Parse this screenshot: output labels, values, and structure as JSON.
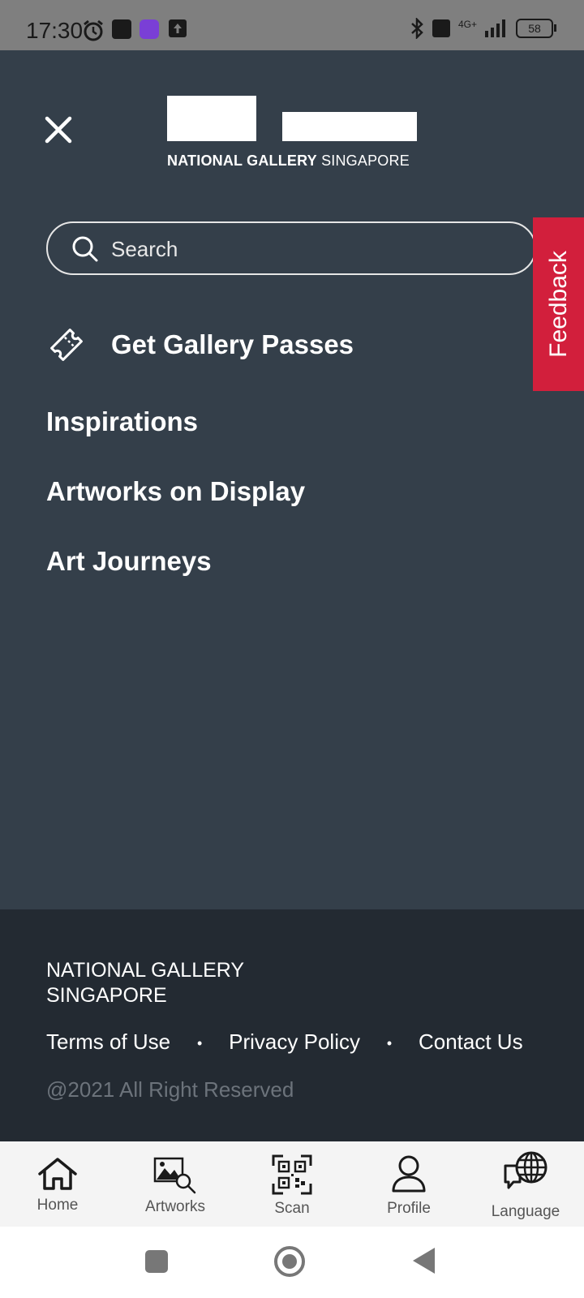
{
  "status_bar": {
    "time": "17:30",
    "network": "4G+",
    "battery": "58"
  },
  "logo": {
    "brand_bold": "NATIONAL GALLERY",
    "brand_light": "SINGAPORE"
  },
  "search": {
    "placeholder": "Search"
  },
  "menu": {
    "passes_label": "Get Gallery Passes",
    "items": [
      "Inspirations",
      "Artworks on Display",
      "Art Journeys"
    ]
  },
  "feedback": {
    "label": "Feedback"
  },
  "footer": {
    "org_line1": "NATIONAL GALLERY",
    "org_line2": "SINGAPORE",
    "links": [
      "Terms of Use",
      "Privacy Policy",
      "Contact Us"
    ],
    "separator": "•",
    "copyright": "@2021 All Right Reserved"
  },
  "bottom_nav": [
    {
      "label": "Home",
      "icon": "home-icon"
    },
    {
      "label": "Artworks",
      "icon": "artworks-icon"
    },
    {
      "label": "Scan",
      "icon": "qr-scan-icon"
    },
    {
      "label": "Profile",
      "icon": "profile-icon"
    },
    {
      "label": "Language",
      "icon": "language-icon"
    }
  ],
  "colors": {
    "drawer_bg": "#343f4a",
    "footer_bg": "#232a32",
    "feedback_bg": "#d21f3c",
    "bottom_nav_bg": "#f4f4f4"
  }
}
